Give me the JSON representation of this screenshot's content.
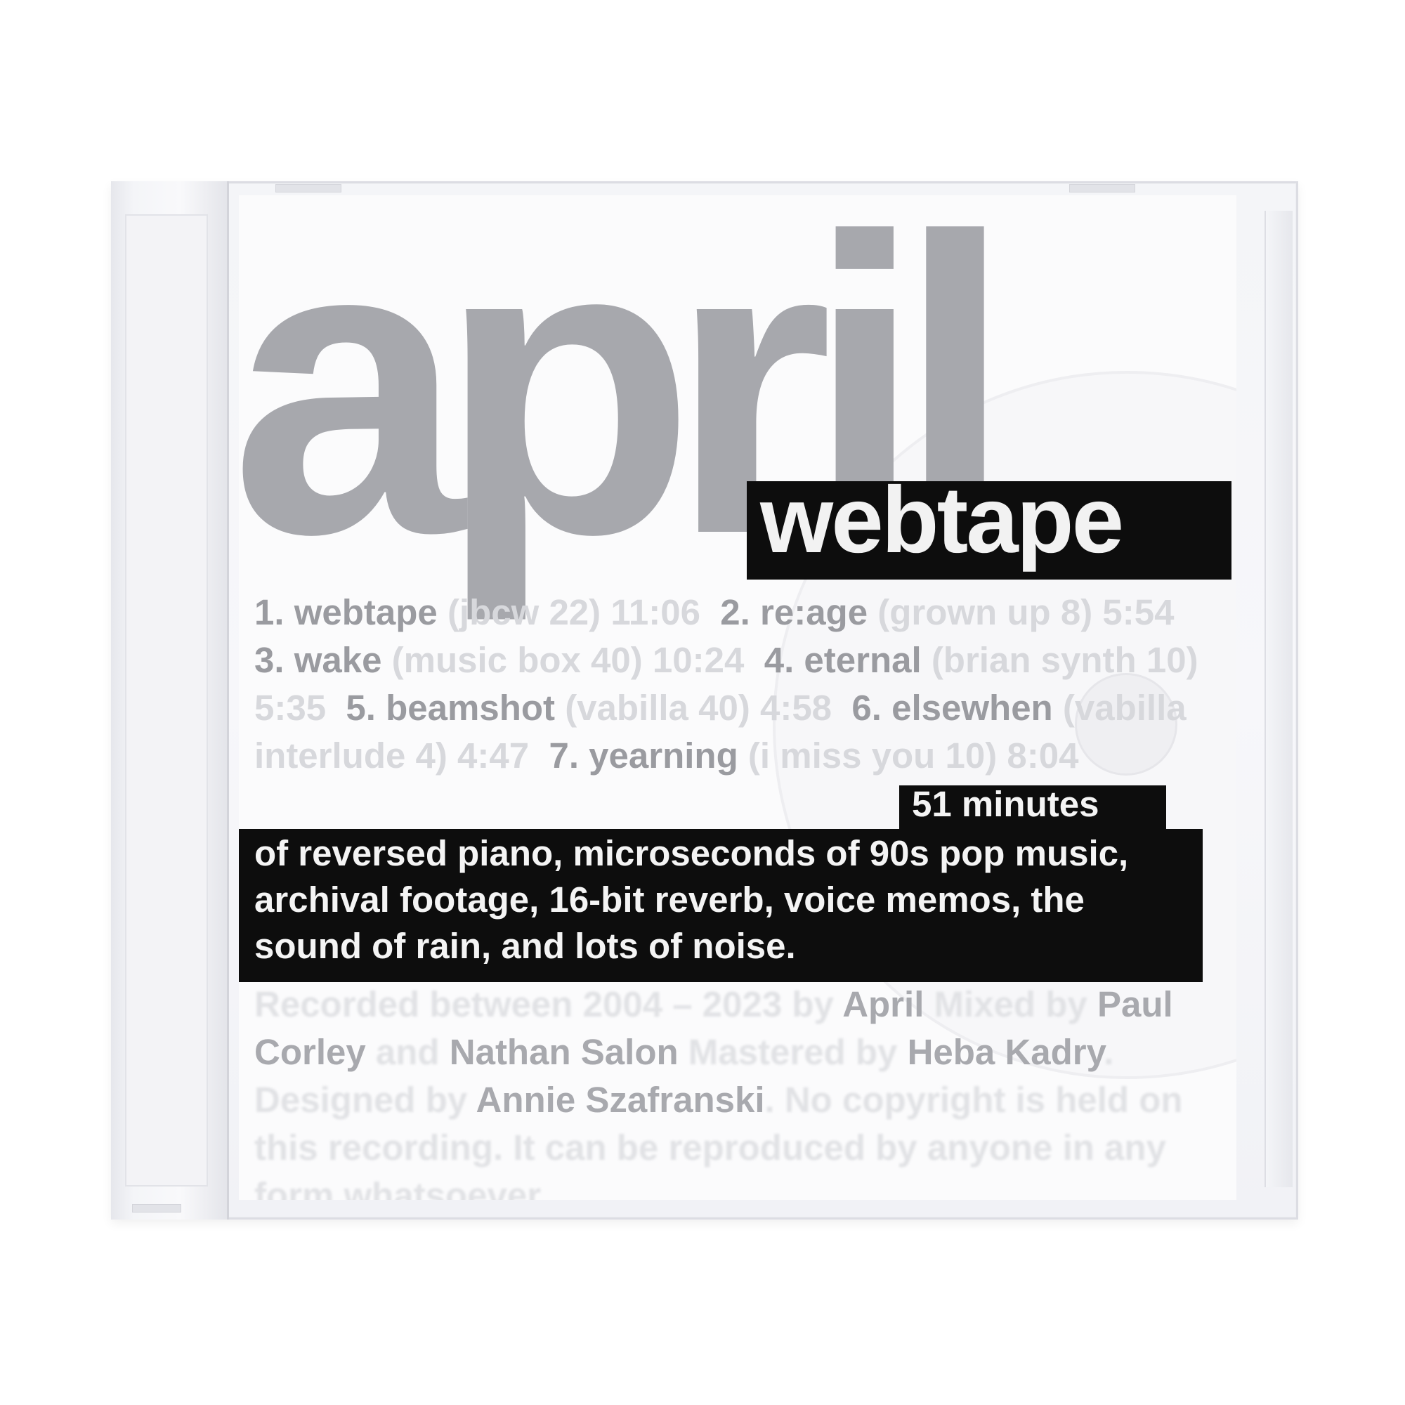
{
  "album": {
    "artist": "april",
    "title": "webtape"
  },
  "tracks": [
    {
      "label": "1. webtape",
      "note": "(jbcw 22) 11:06"
    },
    {
      "label": "2. re:age",
      "note": "(grown up 8) 5:54"
    },
    {
      "label": "3. wake",
      "note": "(music box 40) 10:24"
    },
    {
      "label": "4. eternal",
      "note": "(brian synth 10) 5:35"
    },
    {
      "label": "5. beamshot",
      "note": "(vabilla 40) 4:58"
    },
    {
      "label": "6. elsewhen",
      "note": "(vabilla interlude 4) 4:47"
    },
    {
      "label": "7. yearning",
      "note": "(i miss you 10) 8:04"
    }
  ],
  "description": {
    "lead": "51 minutes",
    "body": "of reversed piano, microseconds of 90s pop music, archival footage, 16-bit reverb, voice memos, the sound of rain, and lots of noise."
  },
  "credits": {
    "recorded": "Recorded between 2004 – 2023 by",
    "artist_name": "April",
    "mixed": "Mixed by",
    "mixer1": "Paul Corley",
    "and": "and",
    "mixer2": "Nathan Salon",
    "mastered": "Mastered by",
    "masterer": "Heba Kadry",
    "designed": "Designed by",
    "designer": "Annie Szafranski",
    "notice": "No copyright is held on this recording. It can be reproduced by anyone in any form whatsoever."
  },
  "colors": {
    "case": "#f4f5f8",
    "artist_text": "#a7a8ad",
    "label_black": "#0d0d0d",
    "label_text": "#f4f4f4"
  }
}
